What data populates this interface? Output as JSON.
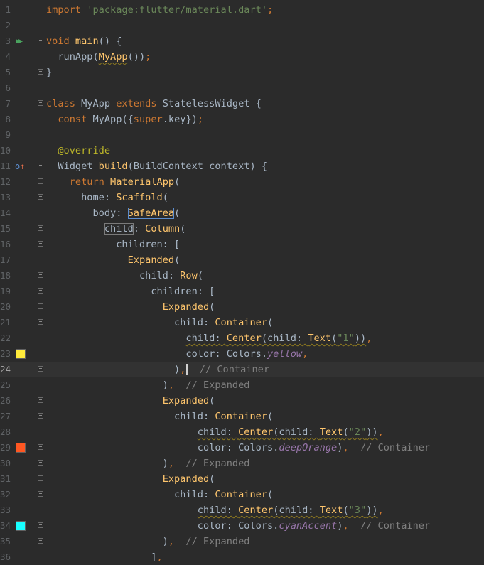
{
  "editor": {
    "current_line": 24,
    "lines": [
      {
        "n": "1",
        "segs": [
          {
            "t": "import ",
            "c": "kw"
          },
          {
            "t": "'package:flutter/material.dart'",
            "c": "str"
          },
          {
            "t": ";",
            "c": "kw"
          }
        ]
      },
      {
        "n": "2",
        "segs": []
      },
      {
        "n": "3",
        "icon": "run-gutter-icon",
        "fold": "open",
        "segs": [
          {
            "t": "void ",
            "c": "kw"
          },
          {
            "t": "main",
            "c": "cls"
          },
          {
            "t": "() {",
            "c": ""
          }
        ]
      },
      {
        "n": "4",
        "segs": [
          {
            "t": "  runApp(",
            "c": ""
          },
          {
            "t": "MyApp",
            "c": "cls sq"
          },
          {
            "t": "())",
            "c": ""
          },
          {
            "t": ";",
            "c": "kw"
          }
        ]
      },
      {
        "n": "5",
        "fold": "end",
        "segs": [
          {
            "t": "}",
            "c": ""
          }
        ]
      },
      {
        "n": "6",
        "segs": []
      },
      {
        "n": "7",
        "fold": "open",
        "segs": [
          {
            "t": "class ",
            "c": "kw"
          },
          {
            "t": "MyApp ",
            "c": ""
          },
          {
            "t": "extends ",
            "c": "kw"
          },
          {
            "t": "StatelessWidget {",
            "c": ""
          }
        ]
      },
      {
        "n": "8",
        "segs": [
          {
            "t": "  ",
            "c": ""
          },
          {
            "t": "const ",
            "c": "kw"
          },
          {
            "t": "MyApp({",
            "c": ""
          },
          {
            "t": "super",
            "c": "kw"
          },
          {
            "t": ".key})",
            "c": ""
          },
          {
            "t": ";",
            "c": "kw"
          }
        ]
      },
      {
        "n": "9",
        "segs": []
      },
      {
        "n": "10",
        "segs": [
          {
            "t": "  ",
            "c": ""
          },
          {
            "t": "@override",
            "c": "ann"
          }
        ]
      },
      {
        "n": "11",
        "icon": "override-gutter-icon",
        "fold": "open",
        "segs": [
          {
            "t": "  Widget ",
            "c": ""
          },
          {
            "t": "build",
            "c": "cls"
          },
          {
            "t": "(BuildContext context) {",
            "c": ""
          }
        ]
      },
      {
        "n": "12",
        "fold": "open",
        "segs": [
          {
            "t": "    ",
            "c": ""
          },
          {
            "t": "return ",
            "c": "kw"
          },
          {
            "t": "MaterialApp",
            "c": "cls"
          },
          {
            "t": "(",
            "c": ""
          }
        ]
      },
      {
        "n": "13",
        "fold": "open",
        "segs": [
          {
            "t": "      home: ",
            "c": ""
          },
          {
            "t": "Scaffold",
            "c": "cls"
          },
          {
            "t": "(",
            "c": ""
          }
        ]
      },
      {
        "n": "14",
        "fold": "open",
        "segs": [
          {
            "t": "        body: ",
            "c": ""
          },
          {
            "t": "SafeArea",
            "c": "cls box"
          },
          {
            "t": "(",
            "c": ""
          }
        ]
      },
      {
        "n": "15",
        "fold": "open",
        "segs": [
          {
            "t": "          ",
            "c": ""
          },
          {
            "t": "child",
            "c": "boxgray"
          },
          {
            "t": ": ",
            "c": ""
          },
          {
            "t": "Column",
            "c": "cls"
          },
          {
            "t": "(",
            "c": ""
          }
        ]
      },
      {
        "n": "16",
        "fold": "open",
        "segs": [
          {
            "t": "            children: [",
            "c": ""
          }
        ]
      },
      {
        "n": "17",
        "fold": "open",
        "segs": [
          {
            "t": "              ",
            "c": ""
          },
          {
            "t": "Expanded",
            "c": "cls"
          },
          {
            "t": "(",
            "c": ""
          }
        ]
      },
      {
        "n": "18",
        "fold": "open",
        "segs": [
          {
            "t": "                child: ",
            "c": ""
          },
          {
            "t": "Row",
            "c": "cls"
          },
          {
            "t": "(",
            "c": ""
          }
        ]
      },
      {
        "n": "19",
        "fold": "open",
        "segs": [
          {
            "t": "                  children: [",
            "c": ""
          }
        ]
      },
      {
        "n": "20",
        "fold": "open",
        "segs": [
          {
            "t": "                    ",
            "c": ""
          },
          {
            "t": "Expanded",
            "c": "cls"
          },
          {
            "t": "(",
            "c": ""
          }
        ]
      },
      {
        "n": "21",
        "fold": "open",
        "segs": [
          {
            "t": "                      child: ",
            "c": ""
          },
          {
            "t": "Container",
            "c": "cls"
          },
          {
            "t": "(",
            "c": ""
          }
        ]
      },
      {
        "n": "22",
        "segs": [
          {
            "t": "                        ",
            "c": ""
          },
          {
            "t": "child: ",
            "c": "sq"
          },
          {
            "t": "Center",
            "c": "cls sq"
          },
          {
            "t": "(child: ",
            "c": "sq"
          },
          {
            "t": "Text",
            "c": "cls sq"
          },
          {
            "t": "(",
            "c": "sq"
          },
          {
            "t": "\"1\"",
            "c": "str sq"
          },
          {
            "t": "))",
            "c": "sq"
          },
          {
            "t": ",",
            "c": "kw"
          }
        ]
      },
      {
        "n": "23",
        "icon": "yellow-swatch",
        "segs": [
          {
            "t": "                        color: Colors.",
            "c": ""
          },
          {
            "t": "yellow",
            "c": "fld"
          },
          {
            "t": ",",
            "c": "kw"
          }
        ]
      },
      {
        "n": "24",
        "fold": "end",
        "caret": true,
        "segs": [
          {
            "t": "                      )",
            "c": ""
          },
          {
            "t": ",",
            "c": "kw"
          },
          {
            "t": "  // Container",
            "c": "cmt"
          }
        ]
      },
      {
        "n": "25",
        "fold": "end",
        "segs": [
          {
            "t": "                    )",
            "c": ""
          },
          {
            "t": ",",
            "c": "kw"
          },
          {
            "t": "  // Expanded",
            "c": "cmt"
          }
        ]
      },
      {
        "n": "26",
        "fold": "open",
        "segs": [
          {
            "t": "                    ",
            "c": ""
          },
          {
            "t": "Expanded",
            "c": "cls"
          },
          {
            "t": "(",
            "c": ""
          }
        ]
      },
      {
        "n": "27",
        "fold": "open",
        "segs": [
          {
            "t": "                      child: ",
            "c": ""
          },
          {
            "t": "Container",
            "c": "cls"
          },
          {
            "t": "(",
            "c": ""
          }
        ]
      },
      {
        "n": "28",
        "segs": [
          {
            "t": "                          ",
            "c": ""
          },
          {
            "t": "child: ",
            "c": "sq"
          },
          {
            "t": "Center",
            "c": "cls sq"
          },
          {
            "t": "(child: ",
            "c": "sq"
          },
          {
            "t": "Text",
            "c": "cls sq"
          },
          {
            "t": "(",
            "c": "sq"
          },
          {
            "t": "\"2\"",
            "c": "str sq"
          },
          {
            "t": "))",
            "c": "sq"
          },
          {
            "t": ",",
            "c": "kw"
          }
        ]
      },
      {
        "n": "29",
        "icon": "orange-swatch",
        "fold": "end",
        "segs": [
          {
            "t": "                          color: Colors.",
            "c": ""
          },
          {
            "t": "deepOrange",
            "c": "fld"
          },
          {
            "t": ")",
            "c": ""
          },
          {
            "t": ",",
            "c": "kw"
          },
          {
            "t": "  // Container",
            "c": "cmt"
          }
        ]
      },
      {
        "n": "30",
        "fold": "end",
        "segs": [
          {
            "t": "                    )",
            "c": ""
          },
          {
            "t": ",",
            "c": "kw"
          },
          {
            "t": "  // Expanded",
            "c": "cmt"
          }
        ]
      },
      {
        "n": "31",
        "fold": "open",
        "segs": [
          {
            "t": "                    ",
            "c": ""
          },
          {
            "t": "Expanded",
            "c": "cls"
          },
          {
            "t": "(",
            "c": ""
          }
        ]
      },
      {
        "n": "32",
        "fold": "open",
        "segs": [
          {
            "t": "                      child: ",
            "c": ""
          },
          {
            "t": "Container",
            "c": "cls"
          },
          {
            "t": "(",
            "c": ""
          }
        ]
      },
      {
        "n": "33",
        "segs": [
          {
            "t": "                          ",
            "c": ""
          },
          {
            "t": "child: ",
            "c": "sq"
          },
          {
            "t": "Center",
            "c": "cls sq"
          },
          {
            "t": "(child: ",
            "c": "sq"
          },
          {
            "t": "Text",
            "c": "cls sq"
          },
          {
            "t": "(",
            "c": "sq"
          },
          {
            "t": "\"3\"",
            "c": "str sq"
          },
          {
            "t": "))",
            "c": "sq"
          },
          {
            "t": ",",
            "c": "kw"
          }
        ]
      },
      {
        "n": "34",
        "icon": "cyan-swatch",
        "fold": "end",
        "segs": [
          {
            "t": "                          color: Colors.",
            "c": ""
          },
          {
            "t": "cyanAccent",
            "c": "fld"
          },
          {
            "t": ")",
            "c": ""
          },
          {
            "t": ",",
            "c": "kw"
          },
          {
            "t": "  // Container",
            "c": "cmt"
          }
        ]
      },
      {
        "n": "35",
        "fold": "end",
        "segs": [
          {
            "t": "                    )",
            "c": ""
          },
          {
            "t": ",",
            "c": "kw"
          },
          {
            "t": "  // Expanded",
            "c": "cmt"
          }
        ]
      },
      {
        "n": "36",
        "fold": "end",
        "segs": [
          {
            "t": "                  ]",
            "c": ""
          },
          {
            "t": ",",
            "c": "kw"
          }
        ]
      }
    ]
  },
  "colors": {
    "background": "#2b2b2b",
    "current_line": "#323232",
    "yellow-swatch": "#ffeb3b",
    "orange-swatch": "#ff5722",
    "cyan-swatch": "#18ffff"
  }
}
